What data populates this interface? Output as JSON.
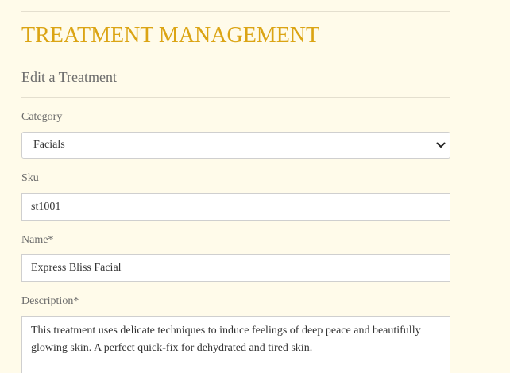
{
  "page": {
    "title": "TREATMENT MANAGEMENT",
    "subtitle": "Edit a Treatment",
    "accent_color": "#dba414",
    "background_color": "#fffbea"
  },
  "form": {
    "category": {
      "label": "Category",
      "selected": "Facials",
      "icon": "chevron-down-icon"
    },
    "sku": {
      "label": "Sku",
      "value": "st1001"
    },
    "name": {
      "label": "Name*",
      "value": "Express Bliss Facial"
    },
    "description": {
      "label": "Description*",
      "value": "This treatment uses delicate techniques to induce feelings of deep peace and beautifully glowing skin. A perfect quick-fix for dehydrated and tired skin."
    }
  }
}
